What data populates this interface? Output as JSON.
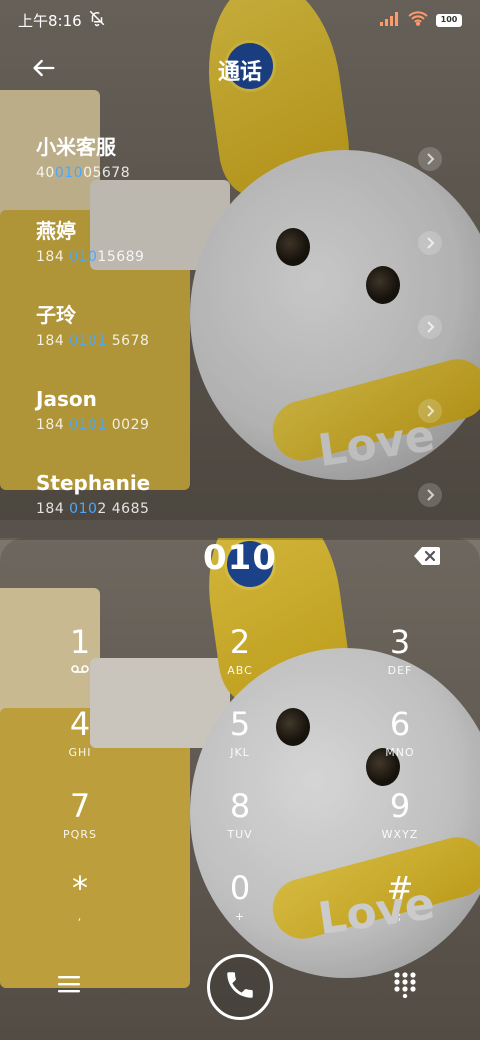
{
  "status_bar": {
    "time": "上午8:16",
    "battery": "100"
  },
  "header": {
    "title": "通话"
  },
  "contacts": [
    {
      "name": "小米客服",
      "num_pre": "40",
      "num_hl": "010",
      "num_post": "05678"
    },
    {
      "name": "燕婷",
      "num_pre": "184 ",
      "num_hl": "010",
      "num_post": "15689"
    },
    {
      "name": "子玲",
      "num_pre": "184 ",
      "num_hl": "0101",
      "num_post": " 5678"
    },
    {
      "name": "Jason",
      "num_pre": "184 ",
      "num_hl": "0101",
      "num_post": " 0029"
    },
    {
      "name": "Stephanie",
      "num_pre": "184 ",
      "num_hl": "010",
      "num_post": "2 4685"
    }
  ],
  "dialer": {
    "number": "010",
    "keys": [
      {
        "digit": "1",
        "letters": ""
      },
      {
        "digit": "2",
        "letters": "ABC"
      },
      {
        "digit": "3",
        "letters": "DEF"
      },
      {
        "digit": "4",
        "letters": "GHI"
      },
      {
        "digit": "5",
        "letters": "JKL"
      },
      {
        "digit": "6",
        "letters": "MNO"
      },
      {
        "digit": "7",
        "letters": "PQRS"
      },
      {
        "digit": "8",
        "letters": "TUV"
      },
      {
        "digit": "9",
        "letters": "WXYZ"
      },
      {
        "digit": "*",
        "letters": ","
      },
      {
        "digit": "0",
        "letters": "+"
      },
      {
        "digit": "#",
        "letters": ";"
      }
    ]
  },
  "icons": {
    "back": "arrow-left-icon",
    "mute": "bell-off-icon",
    "signal": "signal-icon",
    "wifi": "wifi-icon",
    "battery": "battery-icon",
    "backspace": "backspace-icon",
    "menu": "menu-icon",
    "call": "phone-icon",
    "keypad": "keypad-icon",
    "voicemail": "voicemail-icon"
  },
  "colors": {
    "match_highlight": "#4aa8ff",
    "text": "#ffffff"
  }
}
